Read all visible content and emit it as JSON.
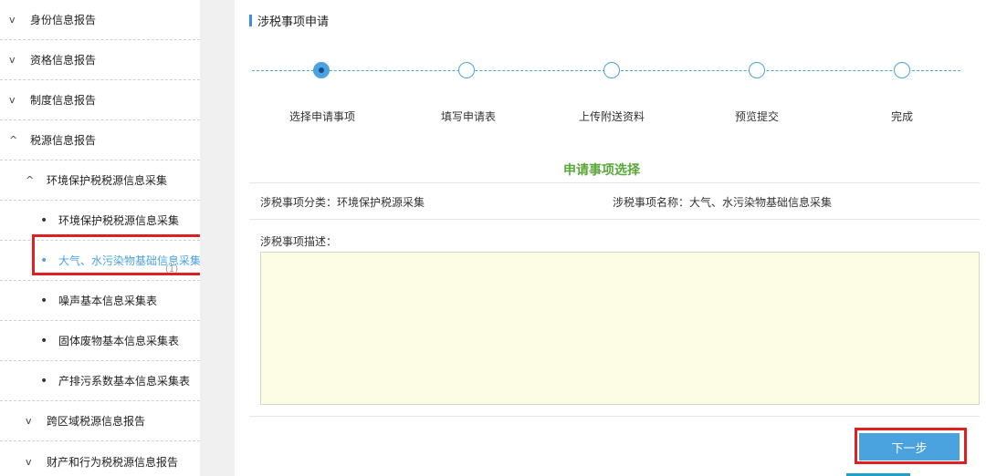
{
  "sidebar": {
    "items": [
      {
        "arrow": "v",
        "label": "身份信息报告"
      },
      {
        "arrow": "v",
        "label": "资格信息报告"
      },
      {
        "arrow": "v",
        "label": "制度信息报告"
      },
      {
        "arrow": "^",
        "label": "税源信息报告"
      },
      {
        "arrow": "^",
        "label": "环境保护税税源信息采集"
      },
      {
        "bullet": "•",
        "label": "环境保护税税源信息采集"
      },
      {
        "bullet": "•",
        "label": "大气、水污染物基础信息采集"
      },
      {
        "bullet": "•",
        "label": "噪声基本信息采集表"
      },
      {
        "bullet": "•",
        "label": "固体废物基本信息采集表"
      },
      {
        "bullet": "•",
        "label": "产排污系数基本信息采集表"
      },
      {
        "arrow": "v",
        "label": "跨区域税源信息报告"
      },
      {
        "arrow": "v",
        "label": "财产和行为税税源信息报告"
      }
    ],
    "active_note": "(1)"
  },
  "main": {
    "title": "涉税事项申请",
    "steps": [
      "选择申请事项",
      "填写申请表",
      "上传附送资料",
      "预览提交",
      "完成"
    ],
    "section_title": "申请事项选择",
    "category": "涉税事项分类：环境保护税源采集",
    "name": "涉税事项名称：大气、水污染物基础信息采集",
    "desc_label": "涉税事项描述：",
    "next_label": "下一步"
  },
  "colors": {
    "accent": "#4aa3df",
    "section_green": "#58a83a",
    "highlight_red": "#e02020",
    "desc_bg": "#fdfde6"
  }
}
